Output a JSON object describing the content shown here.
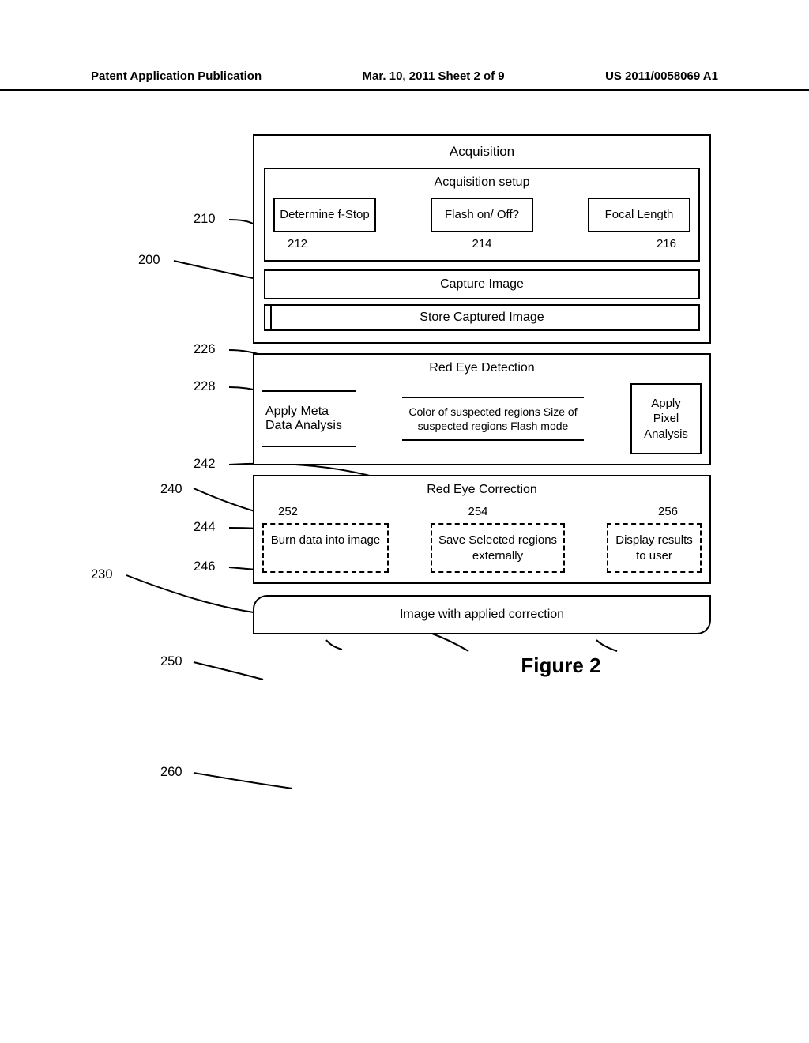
{
  "header": {
    "left": "Patent Application Publication",
    "center": "Mar. 10, 2011  Sheet 2 of 9",
    "right": "US 2011/0058069 A1"
  },
  "labels": {
    "200": "200",
    "210": "210",
    "212": "212",
    "214": "214",
    "216": "216",
    "226": "226",
    "228": "228",
    "230": "230",
    "240": "240",
    "242": "242",
    "244": "244",
    "246": "246",
    "250": "250",
    "252": "252",
    "254": "254",
    "256": "256",
    "260": "260"
  },
  "acquisition": {
    "title": "Acquisition",
    "setup_title": "Acquisition setup",
    "fstop": "Determine f-Stop",
    "flash": "Flash on/ Off?",
    "focal": "Focal Length",
    "capture": "Capture Image",
    "store": "Store Captured Image"
  },
  "detection": {
    "title": "Red Eye Detection",
    "meta": "Apply Meta Data Analysis",
    "arrow_text": "Color of suspected regions Size of suspected regions Flash mode",
    "pixel": "Apply Pixel Analysis"
  },
  "correction": {
    "title": "Red Eye Correction",
    "burn": "Burn data into image",
    "save": "Save Selected regions externally",
    "display": "Display results to user"
  },
  "output": "Image with applied correction",
  "figure": "Figure 2"
}
